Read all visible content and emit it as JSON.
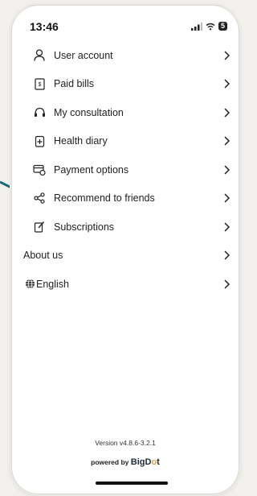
{
  "status_bar": {
    "time": "13:46",
    "battery": "5"
  },
  "menu": [
    {
      "label": "User account",
      "icon": "user-icon"
    },
    {
      "label": "Paid bills",
      "icon": "receipt-icon"
    },
    {
      "label": "My consultation",
      "icon": "headset-icon"
    },
    {
      "label": "Health diary",
      "icon": "diary-icon"
    },
    {
      "label": "Payment options",
      "icon": "card-icon"
    },
    {
      "label": "Recommend to friends",
      "icon": "share-icon"
    },
    {
      "label": "Subscriptions",
      "icon": "subscription-icon"
    }
  ],
  "about_us": "About us",
  "language": {
    "label": "English",
    "icon": "globe-icon"
  },
  "footer": {
    "version": "Version v4.8.6-3.2.1",
    "powered_by": "powered by",
    "brand": "BigDot"
  },
  "colors": {
    "arrow": "#1b6b7a",
    "background": "#f1f0ed",
    "text": "#1f1f1f"
  }
}
